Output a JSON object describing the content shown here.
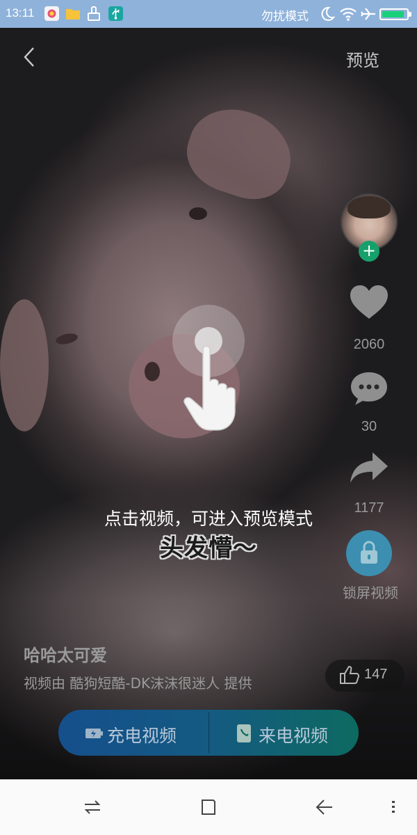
{
  "status_bar": {
    "time": "13:11",
    "dnd_label": "勿扰模式",
    "icons": [
      "app-icon",
      "folder-icon",
      "cleaner-icon",
      "usb-icon",
      "moon-icon",
      "wifi-icon",
      "airplane-icon",
      "battery-icon"
    ],
    "battery_level": 0.9
  },
  "header": {
    "back_icon": "chevron-left-icon",
    "preview_label": "预览"
  },
  "hint": {
    "tap_text": "点击视频，可进入预览模式",
    "caption": "头发懵～"
  },
  "actions": {
    "likes": "2060",
    "comments": "30",
    "shares": "1177",
    "lock_label": "锁屏视频"
  },
  "video_info": {
    "title": "哈哈太可爱",
    "provider": "视频由 酷狗短酷-DK沫沫很迷人 提供",
    "thumbs_up_count": "147"
  },
  "bottom_buttons": {
    "charge_label": "充电视频",
    "call_label": "来电视频"
  },
  "colors": {
    "status_bar": "#8fb2da",
    "follow_green": "#16a06b",
    "lock_blue": "#3c8fb0",
    "button_blue": "#154f8c",
    "button_green": "#0d6a60"
  },
  "nav_icons": [
    "switch-icon",
    "home-square-icon",
    "back-arrow-icon",
    "menu-dots-icon"
  ]
}
